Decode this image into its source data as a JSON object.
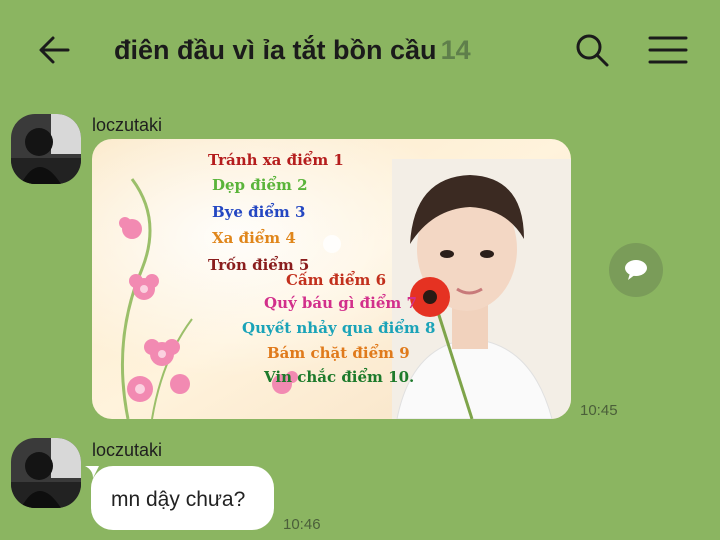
{
  "header": {
    "back_icon": "arrow-left-icon",
    "title": "điên đầu vì ỉa tắt bồn cầu",
    "member_count": "14",
    "search_icon": "search-icon",
    "menu_icon": "hamburger-menu-icon"
  },
  "messages": [
    {
      "sender": "loczutaki",
      "type": "image",
      "poster_lines": [
        "Tránh xa điểm 1",
        "Dẹp điểm 2",
        "Bye điểm 3",
        "Xa điểm 4",
        "Trốn điểm 5",
        "Cấm điểm 6",
        "Quý báu gì điểm 7",
        "Quyết nhảy qua điểm 8",
        "Bám chặt điểm 9",
        "Vin chắc điểm 10."
      ],
      "time": "10:45"
    },
    {
      "sender": "loczutaki",
      "type": "text",
      "text": "mn dậy chưa?",
      "time": "10:46"
    }
  ],
  "colors": {
    "background": "#8bb561",
    "bubble": "#ffffff",
    "member_count": "#5f7f4b"
  }
}
